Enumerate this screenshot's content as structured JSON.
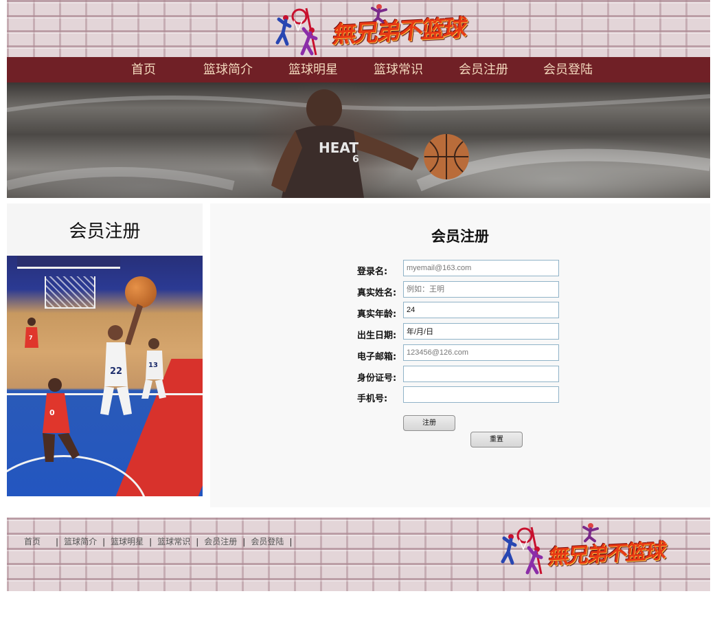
{
  "header": {
    "logo_text": "無兄弟不篮球"
  },
  "nav": {
    "items": [
      {
        "label": "首页"
      },
      {
        "label": "篮球简介"
      },
      {
        "label": "篮球明星"
      },
      {
        "label": "篮球常识"
      },
      {
        "label": "会员注册"
      },
      {
        "label": "会员登陆"
      }
    ]
  },
  "banner": {
    "jersey_text": "HEAT",
    "jersey_number": "6"
  },
  "sidebar": {
    "title": "会员注册",
    "jersey_numbers": [
      "22",
      "13",
      "0",
      "7"
    ]
  },
  "form": {
    "title": "会员注册",
    "fields": [
      {
        "label": "登录名:",
        "value": "",
        "placeholder": "myemail@163.com"
      },
      {
        "label": "真实姓名:",
        "value": "",
        "placeholder": "例如：王明"
      },
      {
        "label": "真实年龄:",
        "value": "24",
        "placeholder": ""
      },
      {
        "label": "出生日期:",
        "value": "年/月/日",
        "placeholder": ""
      },
      {
        "label": "电子邮箱:",
        "value": "",
        "placeholder": "123456@126.com"
      },
      {
        "label": "身份证号:",
        "value": "",
        "placeholder": ""
      },
      {
        "label": "手机号:",
        "value": "",
        "placeholder": ""
      }
    ],
    "submit_label": "注册",
    "reset_label": "重置"
  },
  "footer": {
    "links": [
      {
        "label": "首页"
      },
      {
        "label": "篮球简介"
      },
      {
        "label": "篮球明星"
      },
      {
        "label": "篮球常识"
      },
      {
        "label": "会员注册"
      },
      {
        "label": "会员登陆"
      }
    ],
    "separator": "|",
    "logo_text": "無兄弟不篮球"
  },
  "colors": {
    "nav_bg": "#702026",
    "nav_text": "#f3d9bd",
    "panel_bg": "#f8f8f8",
    "input_border": "#8fb2c7"
  }
}
